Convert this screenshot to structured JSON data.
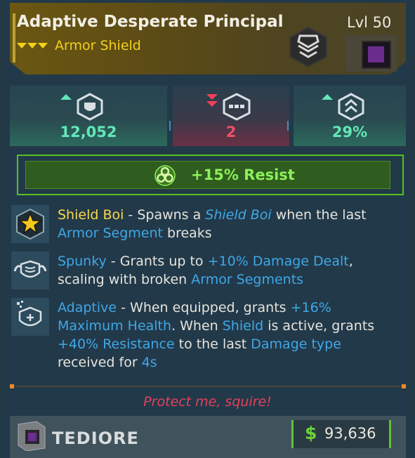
{
  "item": {
    "name": "Adaptive Desperate Principal",
    "level": "Lvl 50",
    "type": "Armor Shield",
    "rarity_color": "#f4d11a"
  },
  "stats": [
    {
      "value": "12,052",
      "trend": "up",
      "icon": "shield-capacity-icon",
      "color": "#63e7b8"
    },
    {
      "value": "2",
      "trend": "double-down",
      "icon": "armor-segment-icon",
      "color": "#f05068"
    },
    {
      "value": "29%",
      "trend": "up",
      "icon": "recharge-rate-icon",
      "color": "#63e7b8"
    }
  ],
  "resist": {
    "text": "+15% Resist",
    "icon": "radiation-hazard-icon"
  },
  "perks": [
    {
      "icon": "star-badge-icon",
      "name": "Shield Boi",
      "sep1": " - Spawns a ",
      "hl1": "Shield Boi",
      "mid1": " when the last ",
      "hl2": "Armor Segment",
      "end": " breaks"
    },
    {
      "icon": "flexing-shield-icon",
      "name": "Spunky",
      "sep1": " - Grants up to ",
      "hl1": "+10% Damage Dealt",
      "mid1": ", scaling with broken ",
      "hl2": "Armor Segments",
      "end": ""
    },
    {
      "icon": "adaptive-shield-icon",
      "name": "Adaptive",
      "sep1": " - When equipped, grants ",
      "hl1": "+16% Maximum Health",
      "mid1": ". When ",
      "hl2": "Shield",
      "mid2": " is active, grants ",
      "hl3": "+40% Resistance",
      "mid3": " to the last ",
      "hl4": "Damage type",
      "mid4": " received for ",
      "hl5": "4s"
    }
  ],
  "flavor_text": "Protect me, squire!",
  "manufacturer": {
    "name": "TEDIORE"
  },
  "price": {
    "currency": "$",
    "value": "93,636"
  },
  "colors": {
    "highlight": "#3fa8e6",
    "perk_name_unique": "#f7d94a",
    "flavor": "#e5415a",
    "accent_green": "#57c21f"
  }
}
